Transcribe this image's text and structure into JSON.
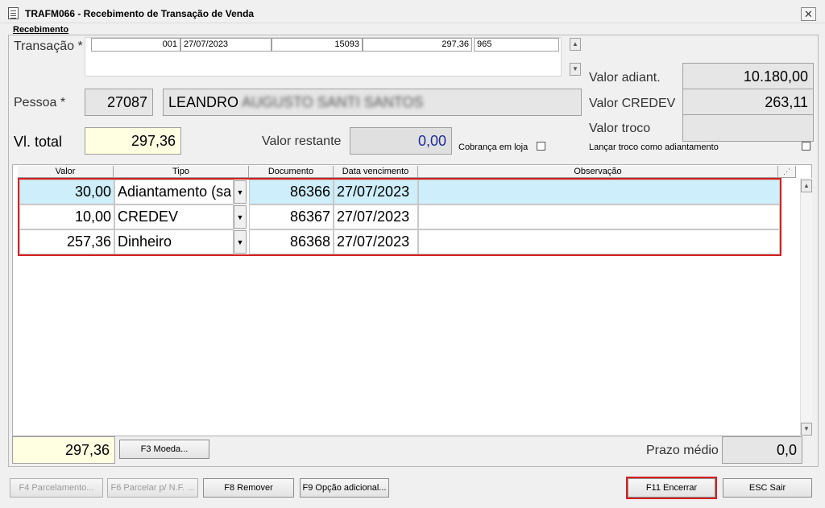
{
  "window": {
    "title": "TRAFM066 - Recebimento de Transação de Venda",
    "close_glyph": "✕"
  },
  "group_label": "Recebimento",
  "transacao": {
    "label": "Transação *",
    "row": {
      "col1": "001",
      "date": "27/07/2023",
      "number": "15093",
      "value": "297,36",
      "code": "965"
    }
  },
  "pessoa": {
    "label": "Pessoa *",
    "code": "27087",
    "name": "LEANDRO",
    "name_redacted": "AUGUSTO SANTI SANTOS"
  },
  "vl_total": {
    "label": "Vl. total",
    "value": "297,36"
  },
  "valor_restante": {
    "label": "Valor restante",
    "value": "0,00"
  },
  "cobranca_em_loja": {
    "label": "Cobrança em loja",
    "checked": false
  },
  "valor_adiant": {
    "label": "Valor adiant.",
    "value": "10.180,00"
  },
  "valor_credev": {
    "label": "Valor CREDEV",
    "value": "263,11"
  },
  "valor_troco": {
    "label": "Valor troco",
    "value": ""
  },
  "lancar_troco": {
    "label": "Lançar troco como adiantamento",
    "checked": false
  },
  "grid": {
    "headers": [
      "Valor",
      "Tipo",
      "Documento",
      "Data vencimento",
      "Observação"
    ],
    "rows": [
      {
        "valor": "30,00",
        "tipo": "Adiantamento (sa",
        "documento": "86366",
        "data": "27/07/2023",
        "obs": ""
      },
      {
        "valor": "10,00",
        "tipo": "CREDEV",
        "documento": "86367",
        "data": "27/07/2023",
        "obs": ""
      },
      {
        "valor": "257,36",
        "tipo": "Dinheiro",
        "documento": "86368",
        "data": "27/07/2023",
        "obs": ""
      }
    ]
  },
  "footer": {
    "total": "297,36",
    "moeda_button": "F3 Moeda...",
    "prazo_medio_label": "Prazo médio",
    "prazo_medio_value": "0,0"
  },
  "buttons": {
    "f4": "F4 Parcelamento...",
    "f6": "F6 Parcelar p/ N.F. ...",
    "f8": "F8 Remover",
    "f9": "F9 Opção adicional...",
    "f11": "F11 Encerrar",
    "esc": "ESC Sair"
  },
  "colors": {
    "highlight": "#d42020",
    "selected_row": "#cdeefa",
    "yellow_field": "#ffffe1",
    "restante_value": "#1f2d9a"
  }
}
